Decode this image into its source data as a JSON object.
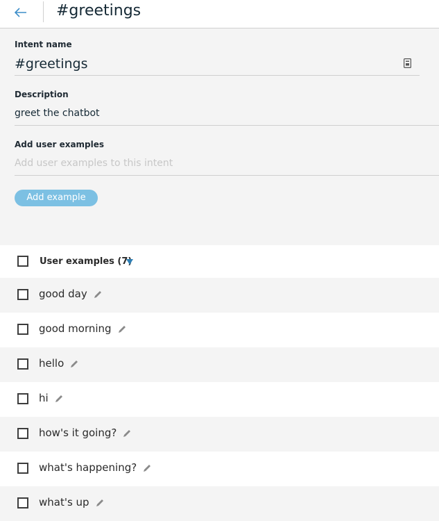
{
  "header": {
    "title": "#greetings",
    "back_icon": "arrow-left-icon"
  },
  "form": {
    "intent_label": "Intent name",
    "intent_value": "#greetings",
    "description_label": "Description",
    "description_value": "greet the chatbot",
    "examples_label": "Add user examples",
    "examples_placeholder": "Add user examples to this intent",
    "add_button": "Add example"
  },
  "table": {
    "header_label": "User examples (7)",
    "rows": [
      "good day",
      "good morning",
      "hello",
      "hi",
      "how's it going?",
      "what's happening?",
      "what's up"
    ]
  },
  "colors": {
    "accent": "#2e7fb5",
    "button": "#7cc0e3",
    "background": "#f4f4f4"
  }
}
